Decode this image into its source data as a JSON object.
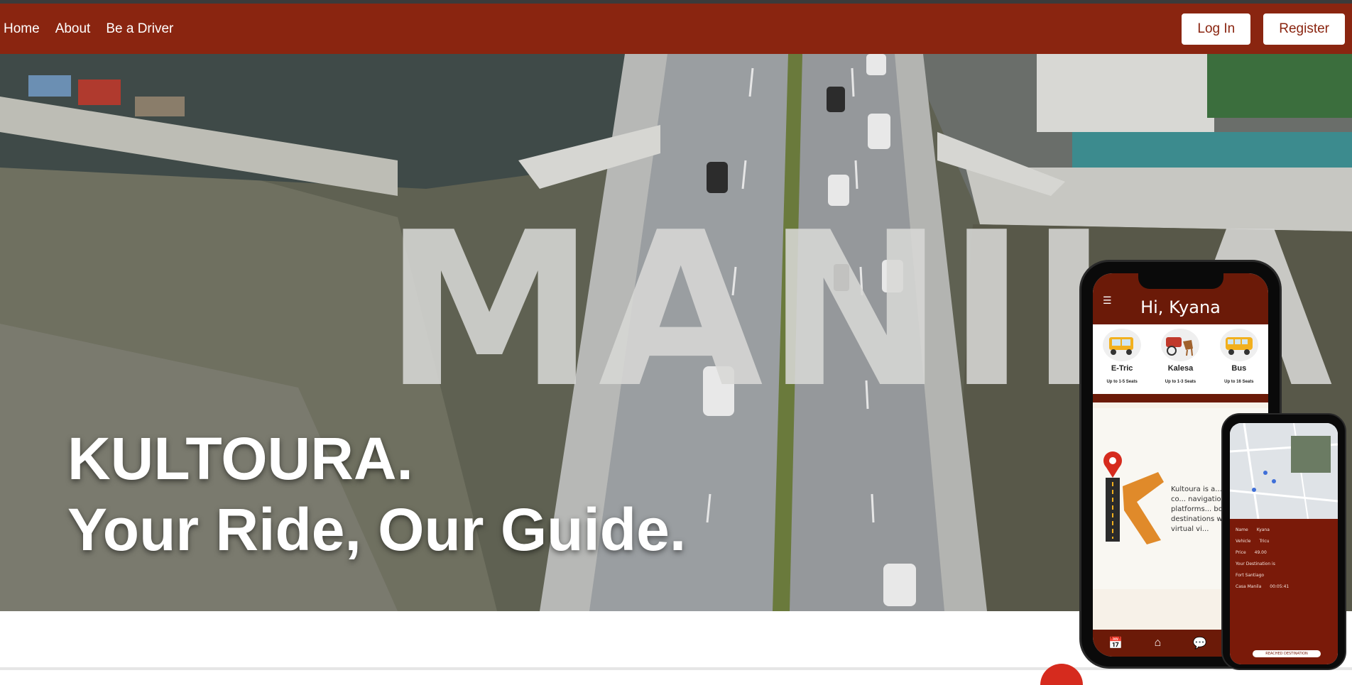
{
  "nav": {
    "links": [
      "Home",
      "About",
      "Be a Driver"
    ],
    "login_label": "Log In",
    "register_label": "Register"
  },
  "hero": {
    "brand": "KULTOURA.",
    "tagline": "Your Ride, Our Guide.",
    "background_word": "MANILA"
  },
  "phone_main": {
    "greeting": "Hi, Kyana",
    "vehicles": [
      {
        "name": "E-Tric",
        "seats": "Up to 1-5 Seats"
      },
      {
        "name": "Kalesa",
        "seats": "Up to 1-3 Seats"
      },
      {
        "name": "Bus",
        "seats": "Up to 16 Seats"
      }
    ],
    "about_text": "Kultoura is a... provides co... navigation too... and platforms... book a ride... destinations w... pinned virtual vi..."
  },
  "phone_secondary": {
    "rows": [
      {
        "label": "Name",
        "value": "Kyana"
      },
      {
        "label": "Vehicle",
        "value": "Tricu"
      },
      {
        "label": "Price",
        "value": "49.00"
      },
      {
        "label": "Your Destination is",
        "value": ""
      },
      {
        "label": "Fort Santiago",
        "value": ""
      },
      {
        "label": "Casa Manila",
        "value": "00:05:41"
      }
    ],
    "button_label": "REACHED DESTINATION"
  },
  "colors": {
    "brand": "#8a2510",
    "brand_dark": "#6b1a08",
    "white": "#ffffff"
  }
}
